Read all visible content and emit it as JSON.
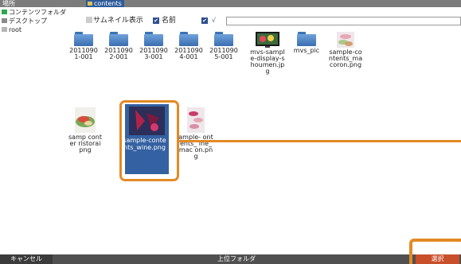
{
  "location": {
    "label": "場所"
  },
  "path": {
    "current": "contents",
    "input_value": ""
  },
  "sidebar": {
    "items": [
      {
        "label": "コンテンツフォルダ",
        "icon": "green-folder-icon"
      },
      {
        "label": "デスクトップ",
        "icon": "desktop-icon"
      },
      {
        "label": "root",
        "icon": "drive-icon"
      }
    ]
  },
  "toolbar": {
    "view_mode": "サムネイル表示",
    "sort": "名前",
    "view_icon": "checkbox-icon",
    "sort_icon": "checkbox-icon",
    "filter_icon": "checkbox-icon"
  },
  "files": [
    {
      "name": "20110901-001",
      "kind": "folder"
    },
    {
      "name": "20110902-001",
      "kind": "folder"
    },
    {
      "name": "20110903-001",
      "kind": "folder"
    },
    {
      "name": "20110904-001",
      "kind": "folder"
    },
    {
      "name": "20110905-001",
      "kind": "folder"
    },
    {
      "name": "mvs-sample-display-shoumen.jpg",
      "kind": "image"
    },
    {
      "name": "mvs_pic",
      "kind": "folder"
    },
    {
      "name": "sample-contents_macoron.png",
      "kind": "image"
    },
    {
      "name": "sample-contents_ristorante.png",
      "kind": "image",
      "shown": "samp conter ristorai png"
    },
    {
      "name": "sample-contents_wine.png",
      "kind": "image",
      "selected": true
    },
    {
      "name": "sample-contents_wine_macoron.png",
      "kind": "image",
      "shown": "ample- ontents_ ine_mac on.png"
    }
  ],
  "bottom": {
    "cancel": "キャンセル",
    "parent": "上位フォルダ",
    "select": "選択"
  },
  "colors": {
    "accent": "#e28a26",
    "selection": "#3461a1",
    "primary_button": "#c94f2a"
  }
}
